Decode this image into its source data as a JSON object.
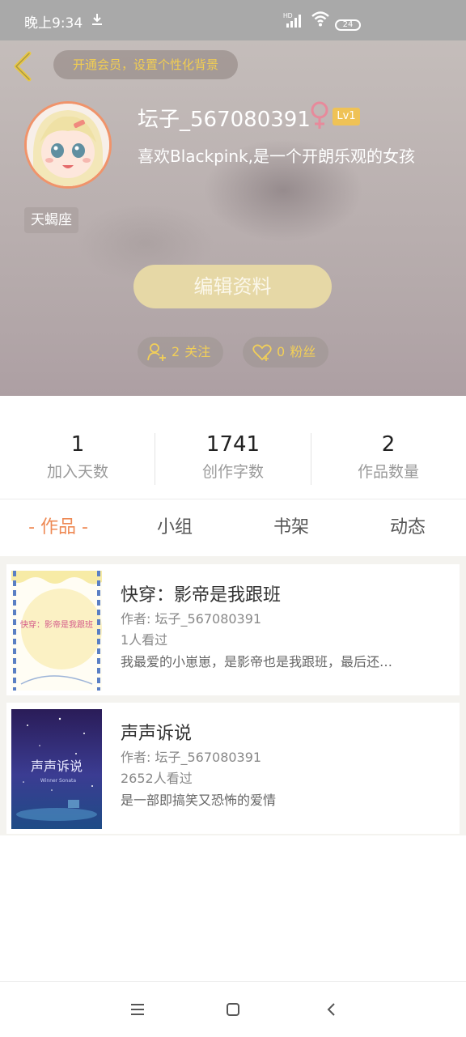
{
  "status_bar": {
    "time": "晚上9:34",
    "network": "HD",
    "battery": "24"
  },
  "header": {
    "vip_banner": "开通会员，设置个性化背景",
    "username": "坛子_567080391",
    "level": "Lv1",
    "bio": "喜欢Blackpink,是一个开朗乐观的女孩",
    "zodiac": "天蝎座",
    "edit_button": "编辑资料",
    "follow_count": "2",
    "follow_label": "关注",
    "fans_count": "0",
    "fans_label": "粉丝",
    "accent_color": "#f1cd52"
  },
  "stats": [
    {
      "value": "1",
      "label": "加入天数"
    },
    {
      "value": "1741",
      "label": "创作字数"
    },
    {
      "value": "2",
      "label": "作品数量"
    }
  ],
  "tabs": [
    {
      "label": "- 作品 -",
      "active": true
    },
    {
      "label": "小组",
      "active": false
    },
    {
      "label": "书架",
      "active": false
    },
    {
      "label": "动态",
      "active": false
    }
  ],
  "works": [
    {
      "title": "快穿：影帝是我跟班",
      "author": "作者: 坛子_567080391",
      "views": "1人看过",
      "description": "我最爱的小崽崽，是影帝也是我跟班，最后还…",
      "cover_text": "快穿：影帝是我跟班"
    },
    {
      "title": "声声诉说",
      "author": "作者: 坛子_567080391",
      "views": "2652人看过",
      "description": "是一部即搞笑又恐怖的爱情",
      "cover_text": "声声诉说",
      "cover_subtext": "Winner Sonata"
    }
  ],
  "nav_bar": {
    "icons": [
      "menu-icon",
      "home-icon",
      "back-icon"
    ]
  }
}
